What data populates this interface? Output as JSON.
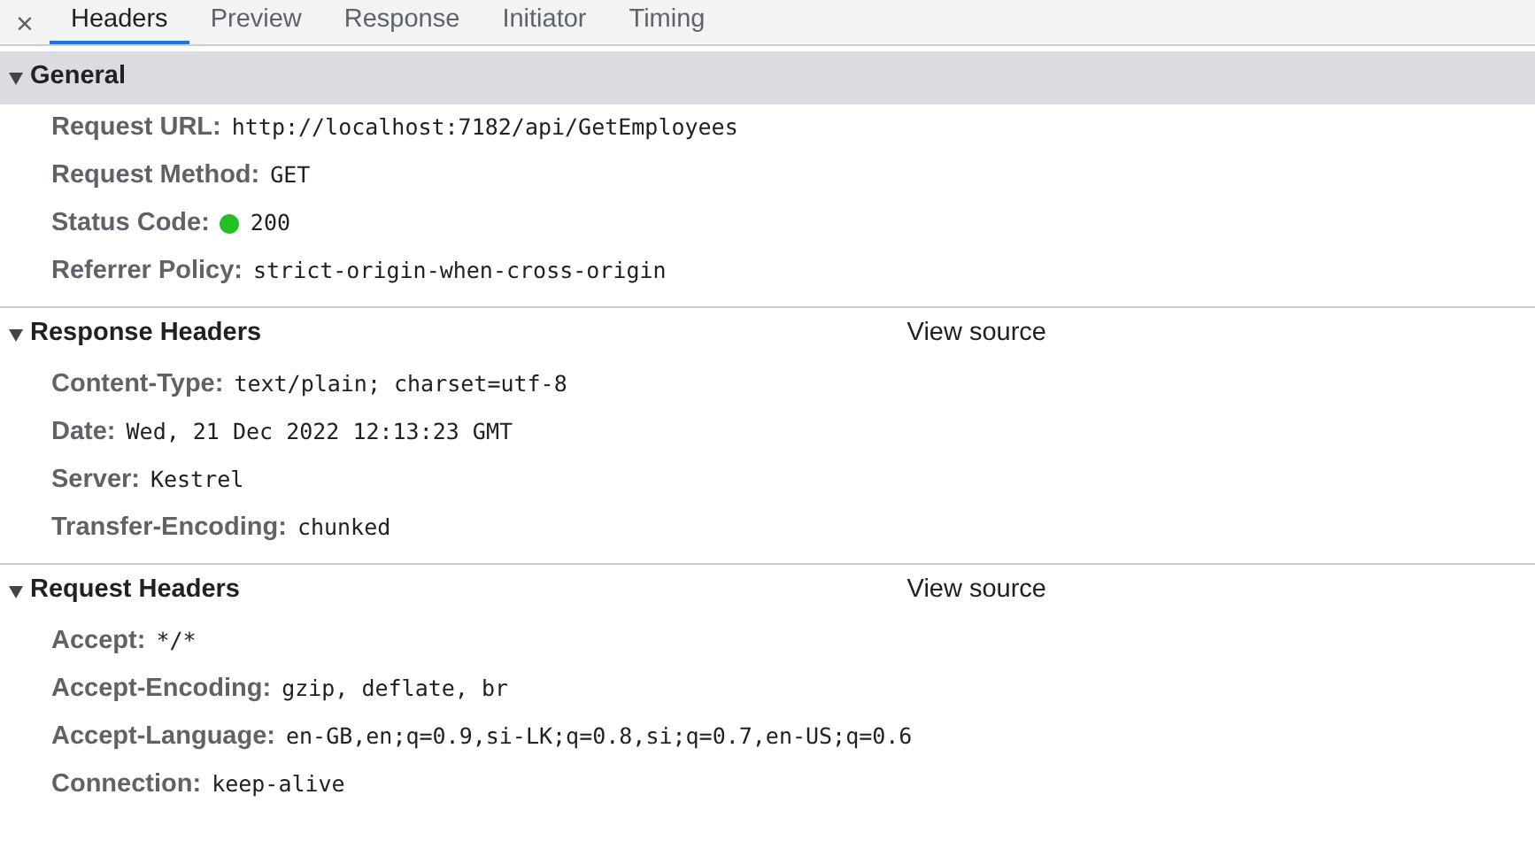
{
  "close_icon": "×",
  "tabs": [
    {
      "label": "Headers",
      "selected": true
    },
    {
      "label": "Preview",
      "selected": false
    },
    {
      "label": "Response",
      "selected": false
    },
    {
      "label": "Initiator",
      "selected": false
    },
    {
      "label": "Timing",
      "selected": false
    }
  ],
  "sections": [
    {
      "title": "General",
      "expanded": true,
      "selected": true,
      "rows": [
        {
          "name": "Request URL:",
          "value": "http://localhost:7182/api/GetEmployees"
        },
        {
          "name": "Request Method:",
          "value": "GET"
        },
        {
          "name": "Status Code:",
          "value": "200",
          "color": "#22c022"
        },
        {
          "name": "Referrer Policy:",
          "value": "strict-origin-when-cross-origin"
        }
      ]
    },
    {
      "title": "Response Headers",
      "expanded": true,
      "selected": false,
      "link": "View source",
      "rows": [
        {
          "name": "Content-Type:",
          "value": "text/plain; charset=utf-8"
        },
        {
          "name": "Date:",
          "value": "Wed, 21 Dec 2022 12:13:23 GMT"
        },
        {
          "name": "Server:",
          "value": "Kestrel"
        },
        {
          "name": "Transfer-Encoding:",
          "value": "chunked"
        }
      ]
    },
    {
      "title": "Request Headers",
      "expanded": true,
      "selected": false,
      "link": "View source",
      "rows": [
        {
          "name": "Accept:",
          "value": "*/*"
        },
        {
          "name": "Accept-Encoding:",
          "value": "gzip, deflate, br"
        },
        {
          "name": "Accept-Language:",
          "value": "en-GB,en;q=0.9,si-LK;q=0.8,si;q=0.7,en-US;q=0.6"
        },
        {
          "name": "Connection:",
          "value": "keep-alive"
        }
      ]
    }
  ]
}
